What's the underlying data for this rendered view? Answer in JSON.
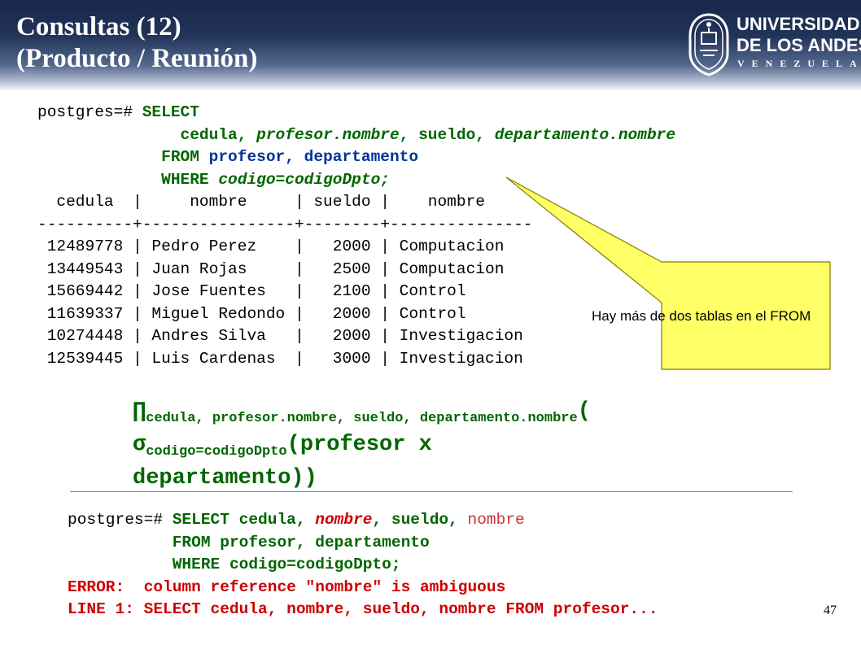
{
  "slide": {
    "title_line1": "Consultas (12)",
    "title_line2": "(Producto / Reunión)",
    "page_number": "47"
  },
  "logo": {
    "text_line1": "UNIVERSIDAD",
    "text_line2": "DE LOS ANDES",
    "text_line3": "VENEZUELA"
  },
  "query1": {
    "prompt": "postgres=# ",
    "select": "SELECT",
    "cols_indent": "               ",
    "col1": "cedula, ",
    "col2": "profesor.nombre",
    "col2_sep": ", ",
    "col3": "sueldo, ",
    "col4": "departamento.nombre",
    "from_indent": "             ",
    "from_kw": "FROM ",
    "from_tables": "profesor, departamento",
    "where_indent": "             ",
    "where_kw": "WHERE ",
    "where_cond": "codigo=codigoDpto;"
  },
  "result_table": {
    "header": "  cedula  |     nombre     | sueldo |    nombre",
    "separator": "----------+----------------+--------+---------------",
    "rows": [
      " 12489778 | Pedro Perez    |   2000 | Computacion",
      " 13449543 | Juan Rojas     |   2500 | Computacion",
      " 15669442 | Jose Fuentes   |   2100 | Control",
      " 11639337 | Miguel Redondo |   2000 | Control",
      " 10274448 | Andres Silva   |   2000 | Investigacion",
      " 12539445 | Luis Cardenas  |   3000 | Investigacion"
    ]
  },
  "callout": {
    "text": "Hay más de dos tablas en el FROM"
  },
  "algebra": {
    "pi": "∏",
    "pi_sub": "cedula, profesor.nombre, sueldo, departamento.nombre",
    "open_paren": "(",
    "sigma": "σ",
    "sigma_sub": "codigo=codigoDpto",
    "inner": "(profesor x",
    "line3": "departamento))"
  },
  "query2": {
    "prompt": "postgres=# ",
    "select": "SELECT ",
    "col1": "cedula, ",
    "col2": "nombre",
    "col2_sep": ", ",
    "col3": "sueldo, ",
    "col4": "nombre",
    "from_indent": "           ",
    "from_line": "FROM profesor, departamento",
    "where_indent": "           ",
    "where_line": "WHERE codigo=codigoDpto;",
    "error_line1": "ERROR:  column reference \"nombre\" is ambiguous",
    "error_line2": "LINE 1: SELECT cedula, nombre, sueldo, nombre FROM profesor..."
  },
  "colors": {
    "header_dark": "#17274a",
    "keyword_green": "#006600",
    "table_blue": "#003399",
    "error_red": "#cc0000",
    "callout_fill": "#ffff66",
    "callout_border": "#808000"
  }
}
